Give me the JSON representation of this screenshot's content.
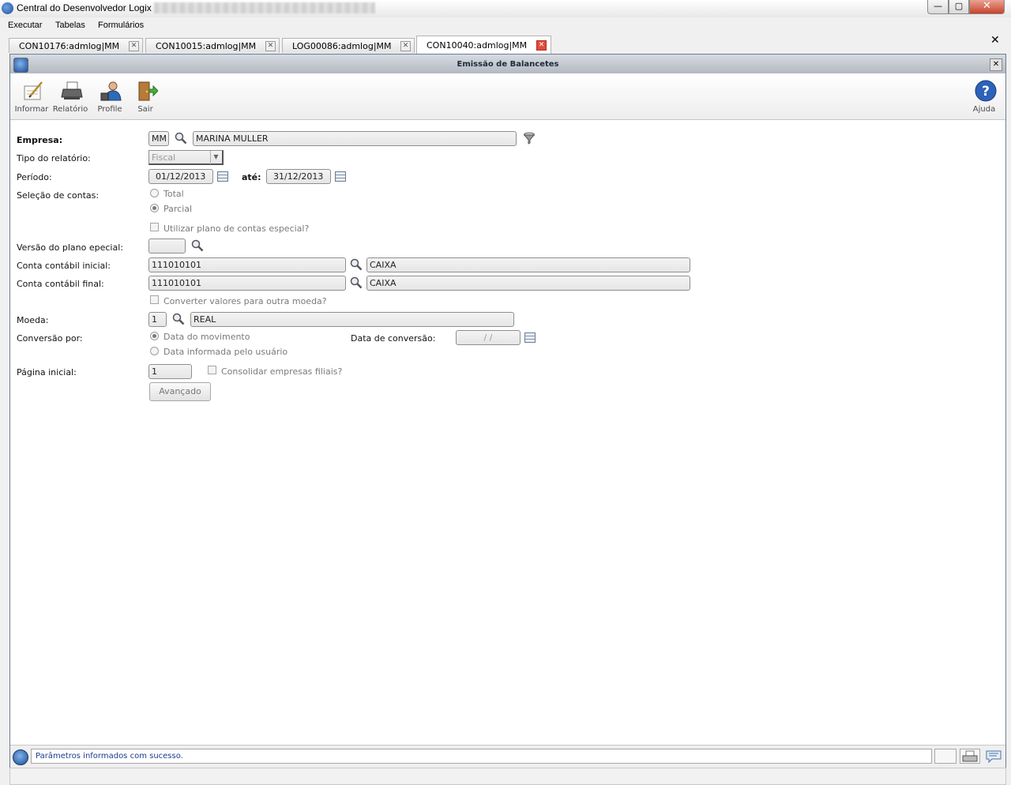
{
  "window": {
    "title": "Central do Desenvolvedor Logix",
    "buttons": {
      "minimize": "—",
      "maximize": "▢",
      "close": "✕"
    }
  },
  "menu": [
    "Executar",
    "Tabelas",
    "Formulários"
  ],
  "tabs": [
    {
      "label": "CON10176:admlog|MM",
      "active": false
    },
    {
      "label": "CON10015:admlog|MM",
      "active": false
    },
    {
      "label": "LOG00086:admlog|MM",
      "active": false
    },
    {
      "label": "CON10040:admlog|MM",
      "active": true
    }
  ],
  "app_close": "✕",
  "form_window": {
    "title": "Emissão de Balancetes",
    "close": "✕"
  },
  "toolbar": {
    "informar": "Informar",
    "relatorio": "Relatório",
    "profile": "Profile",
    "sair": "Sair",
    "ajuda": "Ajuda"
  },
  "fields": {
    "empresa": {
      "label": "Empresa:",
      "code": "MM",
      "name": "MARINA MULLER"
    },
    "tipo_relatorio": {
      "label": "Tipo do relatório:",
      "value": "Fiscal"
    },
    "periodo": {
      "label": "Período:",
      "from": "01/12/2013",
      "ate_label": "até:",
      "to": "31/12/2013"
    },
    "selecao_contas": {
      "label": "Seleção de contas:",
      "options": [
        "Total",
        "Parcial"
      ],
      "selected": "Parcial"
    },
    "plano_especial_check": "Utilizar plano de contas especial?",
    "versao_plano": {
      "label": "Versão do plano epecial:",
      "value": ""
    },
    "conta_inicial": {
      "label": "Conta contábil inicial:",
      "code": "111010101",
      "name": "CAIXA"
    },
    "conta_final": {
      "label": "Conta contábil final:",
      "code": "111010101",
      "name": "CAIXA"
    },
    "converter_check": "Converter valores para outra moeda?",
    "moeda": {
      "label": "Moeda:",
      "code": "1",
      "name": "REAL"
    },
    "conversao": {
      "label": "Conversão por:",
      "options": [
        "Data do movimento",
        "Data informada pelo usuário"
      ],
      "selected": "Data do movimento"
    },
    "data_conversao": {
      "label": "Data de conversão:",
      "value": "/ /"
    },
    "pagina_inicial": {
      "label": "Página inicial:",
      "value": "1"
    },
    "consolidar_check": "Consolidar empresas filiais?",
    "avancado_button": "Avançado"
  },
  "status": {
    "message": "Parâmetros informados com sucesso."
  }
}
